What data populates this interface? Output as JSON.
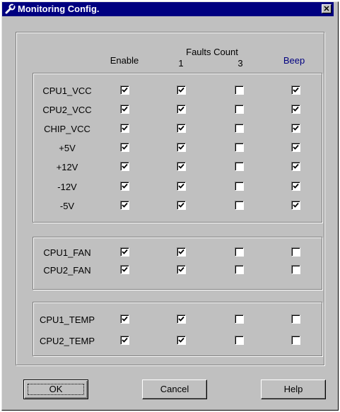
{
  "window": {
    "title": "Monitoring Config."
  },
  "headers": {
    "enable": "Enable",
    "faults": "Faults Count",
    "one": "1",
    "three": "3",
    "beep": "Beep"
  },
  "colors": {
    "titlebar": "#000080",
    "beep": "#000080"
  },
  "rows": [
    {
      "label": "CPU1_VCC",
      "enable": true,
      "f1": true,
      "f3": false,
      "beep": true
    },
    {
      "label": "CPU2_VCC",
      "enable": true,
      "f1": true,
      "f3": false,
      "beep": true
    },
    {
      "label": "CHIP_VCC",
      "enable": true,
      "f1": true,
      "f3": false,
      "beep": true
    },
    {
      "label": "+5V",
      "enable": true,
      "f1": true,
      "f3": false,
      "beep": true
    },
    {
      "label": "+12V",
      "enable": true,
      "f1": true,
      "f3": false,
      "beep": true
    },
    {
      "label": "-12V",
      "enable": true,
      "f1": true,
      "f3": false,
      "beep": true
    },
    {
      "label": "-5V",
      "enable": true,
      "f1": true,
      "f3": false,
      "beep": true
    },
    {
      "label": "CPU1_FAN",
      "enable": true,
      "f1": true,
      "f3": false,
      "beep": false
    },
    {
      "label": "CPU2_FAN",
      "enable": true,
      "f1": true,
      "f3": false,
      "beep": false
    },
    {
      "label": "CPU1_TEMP",
      "enable": true,
      "f1": true,
      "f3": false,
      "beep": false
    },
    {
      "label": "CPU2_TEMP",
      "enable": true,
      "f1": true,
      "f3": false,
      "beep": false
    }
  ],
  "buttons": {
    "ok": "OK",
    "cancel": "Cancel",
    "help": "Help"
  }
}
